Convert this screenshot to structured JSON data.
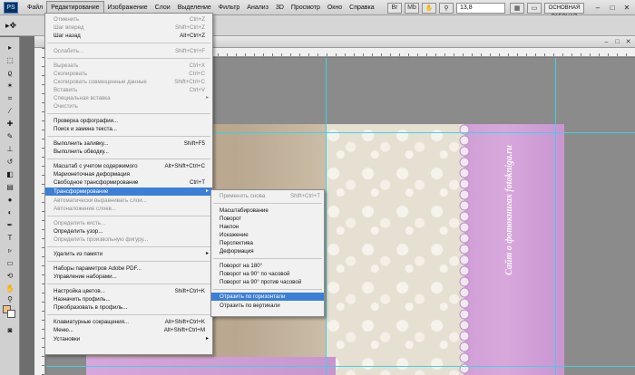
{
  "app": {
    "logo": "PS"
  },
  "menubar": {
    "items": [
      "Файл",
      "Редактирование",
      "Изображение",
      "Слои",
      "Выделение",
      "Фильтр",
      "Анализ",
      "3D",
      "Просмотр",
      "Окно",
      "Справка"
    ],
    "active_index": 1,
    "zoom": "13,8",
    "workspace": "ОСНОВНАЯ РАБОЧАЯ СРЕДА"
  },
  "options_bar": {
    "tool_icon": "move-tool"
  },
  "tools_panel": {
    "foreground_color": "#f2c18a",
    "background_color": "#ffffff"
  },
  "edit_menu": {
    "items": [
      {
        "label": "Отменить",
        "shortcut": "Ctrl+Z",
        "enabled": false
      },
      {
        "label": "Шаг вперед",
        "shortcut": "Shift+Ctrl+Z",
        "enabled": false
      },
      {
        "label": "Шаг назад",
        "shortcut": "Alt+Ctrl+Z",
        "enabled": true
      },
      {
        "label": "Ослабить...",
        "shortcut": "Shift+Ctrl+F",
        "enabled": false
      },
      {
        "label": "Вырезать",
        "shortcut": "Ctrl+X",
        "enabled": false
      },
      {
        "label": "Скопировать",
        "shortcut": "Ctrl+C",
        "enabled": false
      },
      {
        "label": "Скопировать совмещенные данные",
        "shortcut": "Shift+Ctrl+C",
        "enabled": false
      },
      {
        "label": "Вставить",
        "shortcut": "Ctrl+V",
        "enabled": false
      },
      {
        "label": "Специальная вставка",
        "shortcut": "",
        "enabled": false
      },
      {
        "label": "Очистить",
        "shortcut": "",
        "enabled": false
      },
      {
        "label": "Проверка орфографии...",
        "shortcut": "",
        "enabled": true
      },
      {
        "label": "Поиск и замена текста...",
        "shortcut": "",
        "enabled": true
      },
      {
        "label": "Выполнить заливку...",
        "shortcut": "Shift+F5",
        "enabled": true
      },
      {
        "label": "Выполнить обводку...",
        "shortcut": "",
        "enabled": true
      },
      {
        "label": "Масштаб с учетом содержимого",
        "shortcut": "Alt+Shift+Ctrl+C",
        "enabled": true
      },
      {
        "label": "Марионеточная деформация",
        "shortcut": "",
        "enabled": true
      },
      {
        "label": "Свободное трансформирование",
        "shortcut": "Ctrl+T",
        "enabled": true
      },
      {
        "label": "Трансформирование",
        "shortcut": "",
        "enabled": true,
        "submenu": true
      },
      {
        "label": "Автоматически выравнивать слои...",
        "shortcut": "",
        "enabled": false
      },
      {
        "label": "Автоналожение слоев...",
        "shortcut": "",
        "enabled": false
      },
      {
        "label": "Определить кисть...",
        "shortcut": "",
        "enabled": false
      },
      {
        "label": "Определить узор...",
        "shortcut": "",
        "enabled": true
      },
      {
        "label": "Определить произвольную фигуру...",
        "shortcut": "",
        "enabled": false
      },
      {
        "label": "Удалить из памяти",
        "shortcut": "",
        "enabled": true,
        "submenu": true
      },
      {
        "label": "Наборы параметров Adobe PDF...",
        "shortcut": "",
        "enabled": true
      },
      {
        "label": "Управление наборами...",
        "shortcut": "",
        "enabled": true
      },
      {
        "label": "Настройка цветов...",
        "shortcut": "Shift+Ctrl+K",
        "enabled": true
      },
      {
        "label": "Назначить профиль...",
        "shortcut": "",
        "enabled": true
      },
      {
        "label": "Преобразовать в профиль...",
        "shortcut": "",
        "enabled": true
      },
      {
        "label": "Клавиатурные сокращения...",
        "shortcut": "Alt+Shift+Ctrl+K",
        "enabled": true
      },
      {
        "label": "Меню...",
        "shortcut": "Alt+Shift+Ctrl+M",
        "enabled": true
      },
      {
        "label": "Установки",
        "shortcut": "",
        "enabled": true,
        "submenu": true
      }
    ]
  },
  "transform_submenu": {
    "items": [
      {
        "label": "Применить снова",
        "shortcut": "Shift+Ctrl+T",
        "enabled": false
      },
      {
        "label": "Масштабирование",
        "shortcut": "",
        "enabled": true
      },
      {
        "label": "Поворот",
        "shortcut": "",
        "enabled": true
      },
      {
        "label": "Наклон",
        "shortcut": "",
        "enabled": true
      },
      {
        "label": "Искажение",
        "shortcut": "",
        "enabled": true
      },
      {
        "label": "Перспектива",
        "shortcut": "",
        "enabled": true
      },
      {
        "label": "Деформация",
        "shortcut": "",
        "enabled": true
      },
      {
        "label": "Поворот на 180°",
        "shortcut": "",
        "enabled": true
      },
      {
        "label": "Поворот на 90° по часовой",
        "shortcut": "",
        "enabled": true
      },
      {
        "label": "Поворот на 90° против часовой",
        "shortcut": "",
        "enabled": true
      },
      {
        "label": "Отразить по горизонтали",
        "shortcut": "",
        "enabled": true,
        "highlighted": true
      },
      {
        "label": "Отразить по вертикали",
        "shortcut": "",
        "enabled": true
      }
    ]
  },
  "canvas": {
    "watermark": "Сайт о фотокнигах  fotokniga.ru"
  }
}
